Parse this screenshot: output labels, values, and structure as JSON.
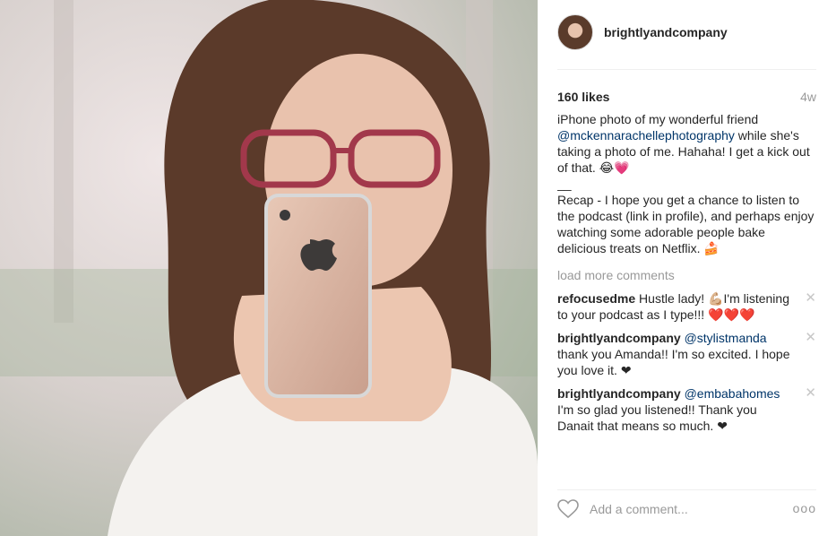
{
  "post": {
    "username": "brightlyandcompany",
    "likes": "160 likes",
    "age": "4w",
    "caption_line1_prefix": "iPhone photo of my wonderful friend ",
    "caption_mention": "@mckennarachellephotography",
    "caption_line1_suffix": " while she's taking a photo of me. Hahaha! I get a kick out of that. 😂💗",
    "caption_separator": "__",
    "caption_recap": "Recap - I hope you get a chance to listen to the podcast (link in profile), and perhaps enjoy watching some adorable people bake delicious treats on Netflix. 🍰",
    "load_more": "load more comments"
  },
  "comments": [
    {
      "user": "refocusedme",
      "mention": "",
      "text": "Hustle lady! 💪🏼I'm listening to your podcast as I type!!! ❤️❤️❤️"
    },
    {
      "user": "brightlyandcompany",
      "mention": "@stylistmanda",
      "text": " thank you Amanda!! I'm so excited. I hope you love it. ❤"
    },
    {
      "user": "brightlyandcompany",
      "mention": "@embabahomes",
      "text": " I'm so glad you listened!! Thank you Danait that means so much. ❤"
    }
  ],
  "footer": {
    "add_comment_placeholder": "Add a comment...",
    "more_label": "ooo"
  },
  "icons": {
    "heart": "heart-icon",
    "close": "close-icon",
    "more": "more-options-icon"
  }
}
